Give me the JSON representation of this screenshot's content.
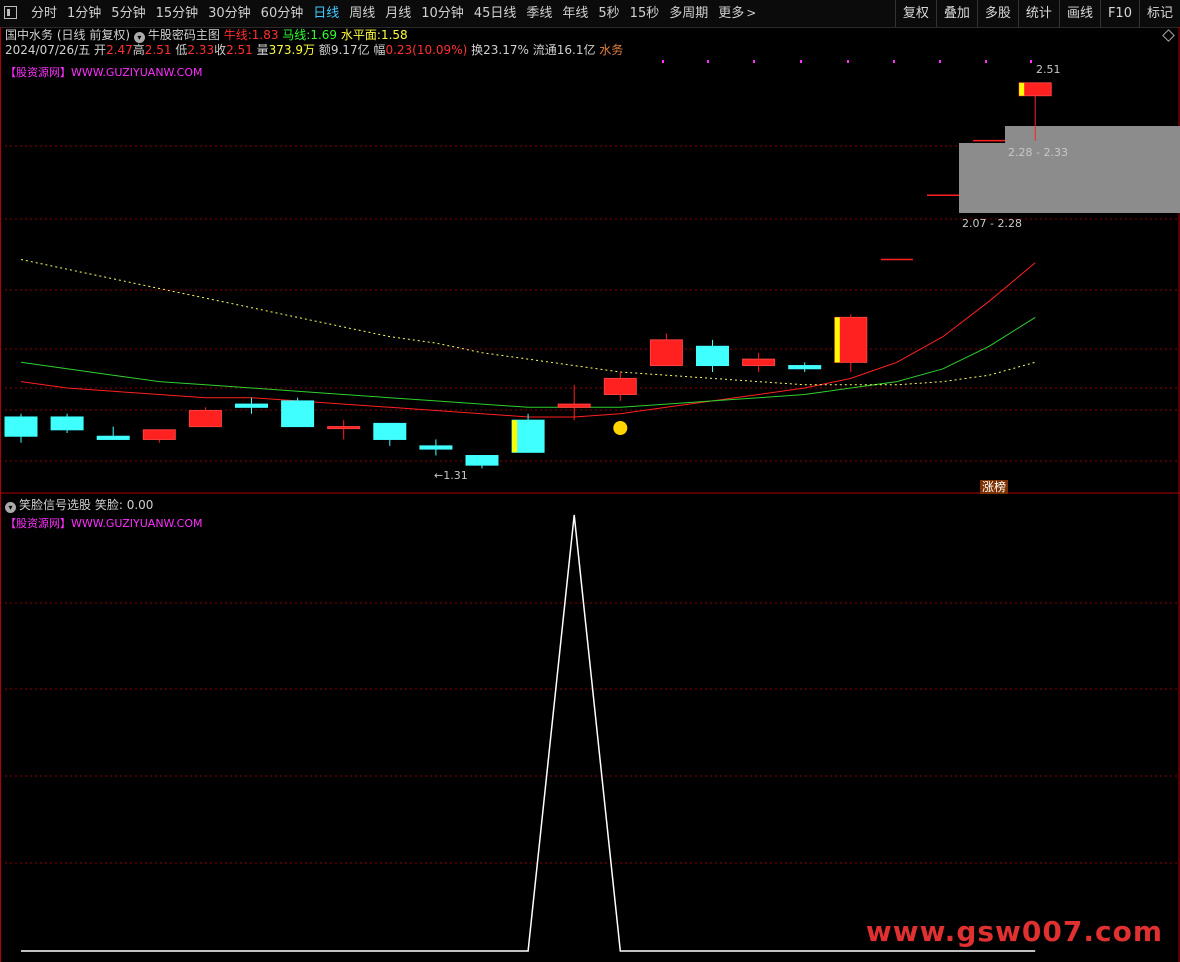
{
  "toolbar": {
    "periods": [
      "分时",
      "1分钟",
      "5分钟",
      "15分钟",
      "30分钟",
      "60分钟",
      "日线",
      "周线",
      "月线",
      "10分钟",
      "45日线",
      "季线",
      "年线",
      "5秒",
      "15秒",
      "多周期",
      "更多"
    ],
    "active_period": "日线",
    "tools": [
      "复权",
      "叠加",
      "多股",
      "统计",
      "画线",
      "F10",
      "标记"
    ]
  },
  "main_panel": {
    "stock_name": "国中水务",
    "mode": "(日线 前复权)",
    "indicator_name": "牛股密码主图",
    "niu_label": "牛线:",
    "niu_value": "1.83",
    "ma_label": "马线:",
    "ma_value": "1.69",
    "level_label": "水平面:",
    "level_value": "1.58",
    "date": "2024/07/26/五",
    "open_label": "开",
    "open": "2.47",
    "high_label": "高",
    "high": "2.51",
    "low_label": "低",
    "low": "2.33",
    "close_label": "收",
    "close": "2.51",
    "volume_label": "量",
    "volume": "373.9万",
    "amount_label": "额",
    "amount": "9.17亿",
    "change_label": "幅",
    "change": "0.23(10.09%)",
    "turnover_label": "换",
    "turnover": "23.17%",
    "float_label": "流通",
    "float_value": "16.1亿",
    "sector": "水务",
    "site_text": "【股资源网】WWW.GUZIYUANW.COM",
    "high_mark": "2.51",
    "low_mark": "1.31",
    "zone_upper_label": "2.28 - 2.33",
    "zone_lower_label": "2.07 - 2.28",
    "tag": "涨榜"
  },
  "sub_panel": {
    "indicator_name": "笑脸信号选股",
    "value_label": "笑脸:",
    "value": "0.00",
    "site_text": "【股资源网】WWW.GUZIYUANW.COM"
  },
  "watermark": "www.gsw007.com",
  "colors": {
    "up": "#ff2020",
    "down": "#40ffff",
    "niu_line": "#ff2020",
    "ma_line": "#30d030",
    "level_line": "#ffff60",
    "grid": "#8b0000",
    "highlight": "#ffff00"
  },
  "chart_data": [
    {
      "type": "candlestick",
      "title": "牛股密码主图",
      "candles": [
        {
          "o": 1.47,
          "h": 1.48,
          "l": 1.39,
          "c": 1.41
        },
        {
          "o": 1.47,
          "h": 1.48,
          "l": 1.42,
          "c": 1.43
        },
        {
          "o": 1.41,
          "h": 1.44,
          "l": 1.4,
          "c": 1.4
        },
        {
          "o": 1.4,
          "h": 1.43,
          "l": 1.39,
          "c": 1.43
        },
        {
          "o": 1.44,
          "h": 1.5,
          "l": 1.44,
          "c": 1.49
        },
        {
          "o": 1.51,
          "h": 1.53,
          "l": 1.48,
          "c": 1.5
        },
        {
          "o": 1.52,
          "h": 1.53,
          "l": 1.44,
          "c": 1.44
        },
        {
          "o": 1.44,
          "h": 1.46,
          "l": 1.4,
          "c": 1.44
        },
        {
          "o": 1.45,
          "h": 1.45,
          "l": 1.38,
          "c": 1.4
        },
        {
          "o": 1.38,
          "h": 1.4,
          "l": 1.35,
          "c": 1.37
        },
        {
          "o": 1.35,
          "h": 1.35,
          "l": 1.31,
          "c": 1.32
        },
        {
          "o": 1.46,
          "h": 1.48,
          "l": 1.36,
          "c": 1.36
        },
        {
          "o": 1.5,
          "h": 1.57,
          "l": 1.46,
          "c": 1.51
        },
        {
          "o": 1.54,
          "h": 1.61,
          "l": 1.52,
          "c": 1.59
        },
        {
          "o": 1.63,
          "h": 1.73,
          "l": 1.63,
          "c": 1.71
        },
        {
          "o": 1.69,
          "h": 1.71,
          "l": 1.61,
          "c": 1.63
        },
        {
          "o": 1.63,
          "h": 1.67,
          "l": 1.61,
          "c": 1.65
        },
        {
          "o": 1.63,
          "h": 1.64,
          "l": 1.61,
          "c": 1.62
        },
        {
          "o": 1.64,
          "h": 1.79,
          "l": 1.61,
          "c": 1.78
        },
        {
          "o": 1.96,
          "h": 1.96,
          "l": 1.96,
          "c": 1.96
        },
        {
          "o": 2.16,
          "h": 2.16,
          "l": 2.16,
          "c": 2.16
        },
        {
          "o": 2.33,
          "h": 2.33,
          "l": 2.33,
          "c": 2.33
        },
        {
          "o": 2.47,
          "h": 2.51,
          "l": 2.33,
          "c": 2.51
        }
      ],
      "series": [
        {
          "name": "牛线",
          "values": [
            1.58,
            1.56,
            1.55,
            1.54,
            1.53,
            1.53,
            1.52,
            1.51,
            1.5,
            1.49,
            1.48,
            1.47,
            1.47,
            1.48,
            1.5,
            1.52,
            1.54,
            1.56,
            1.59,
            1.64,
            1.72,
            1.83,
            1.95
          ]
        },
        {
          "name": "马线",
          "values": [
            1.64,
            1.62,
            1.6,
            1.58,
            1.57,
            1.56,
            1.55,
            1.54,
            1.53,
            1.52,
            1.51,
            1.5,
            1.5,
            1.5,
            1.51,
            1.52,
            1.53,
            1.54,
            1.56,
            1.58,
            1.62,
            1.69,
            1.78
          ]
        },
        {
          "name": "水平面",
          "values": [
            1.96,
            1.93,
            1.9,
            1.87,
            1.84,
            1.81,
            1.78,
            1.75,
            1.72,
            1.7,
            1.67,
            1.65,
            1.63,
            1.61,
            1.6,
            1.59,
            1.58,
            1.57,
            1.57,
            1.57,
            1.58,
            1.6,
            1.64
          ]
        }
      ],
      "ylim": [
        1.28,
        2.55
      ],
      "grid": true
    },
    {
      "type": "line",
      "title": "笑脸信号选股",
      "series": [
        {
          "name": "笑脸",
          "values": [
            0,
            0,
            0,
            0,
            0,
            0,
            0,
            0,
            0,
            0,
            0,
            0,
            1,
            0,
            0,
            0,
            0,
            0,
            0,
            0,
            0,
            0,
            0
          ]
        }
      ],
      "ylim": [
        0,
        1
      ],
      "grid": true
    }
  ]
}
